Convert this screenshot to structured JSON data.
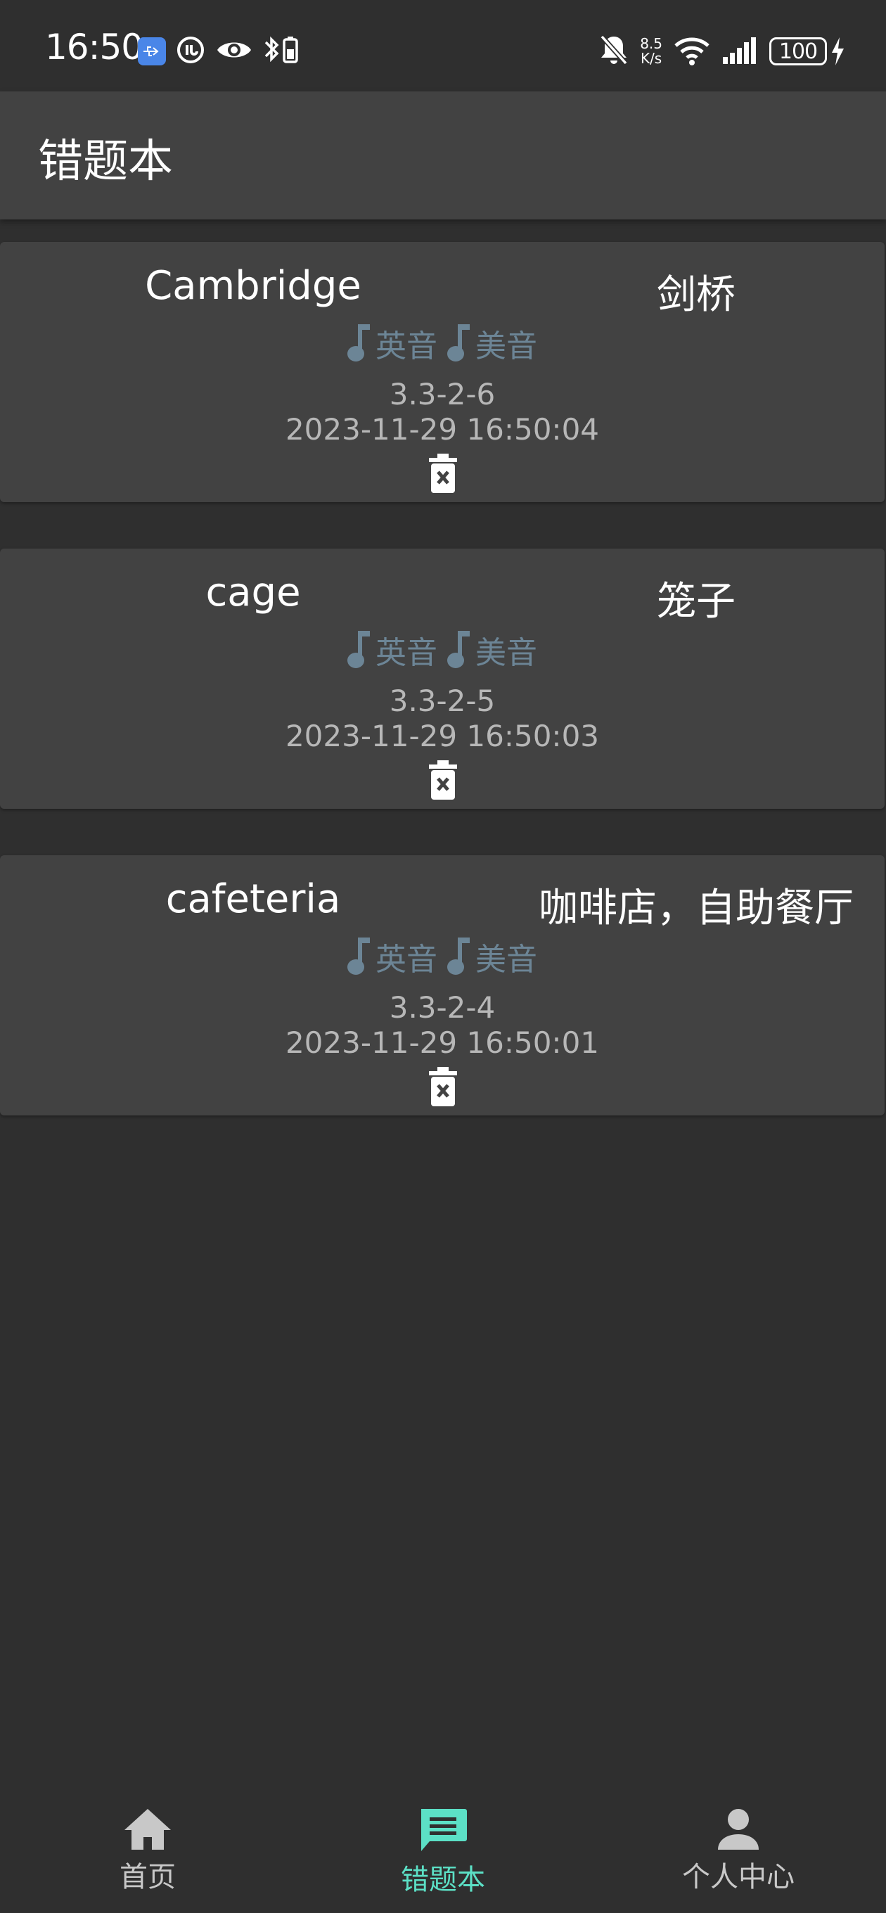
{
  "status_bar": {
    "time": "16:50",
    "net_speed_value": "8.5",
    "net_speed_unit": "K/s",
    "battery": "100"
  },
  "app_bar": {
    "title": "错题本"
  },
  "cards": [
    {
      "word": "Cambridge",
      "meaning": "剑桥",
      "uk_label": "英音",
      "us_label": "美音",
      "unit": "3.3-2-6",
      "timestamp": "2023-11-29 16:50:04"
    },
    {
      "word": "cage",
      "meaning": "笼子",
      "uk_label": "英音",
      "us_label": "美音",
      "unit": "3.3-2-5",
      "timestamp": "2023-11-29 16:50:03"
    },
    {
      "word": "cafeteria",
      "meaning": "咖啡店，自助餐厅",
      "uk_label": "英音",
      "us_label": "美音",
      "unit": "3.3-2-4",
      "timestamp": "2023-11-29 16:50:01"
    }
  ],
  "bottom_nav": {
    "home": "首页",
    "wrongbook": "错题本",
    "profile": "个人中心"
  },
  "colors": {
    "background": "#2f2f2f",
    "card": "#424242",
    "accent": "#5ce0c6",
    "audio": "#6c8596"
  }
}
